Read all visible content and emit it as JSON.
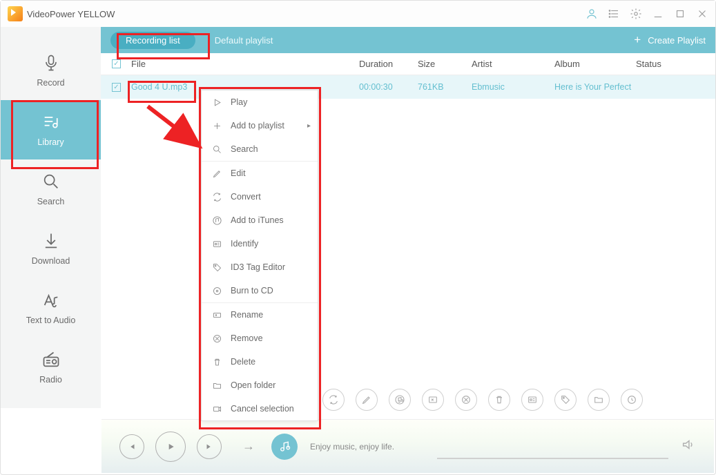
{
  "app_title": "VideoPower YELLOW",
  "sidebar": {
    "items": [
      {
        "label": "Record"
      },
      {
        "label": "Library"
      },
      {
        "label": "Search"
      },
      {
        "label": "Download"
      },
      {
        "label": "Text to Audio"
      },
      {
        "label": "Radio"
      }
    ]
  },
  "tabs": {
    "recording_list": "Recording list",
    "default_playlist": "Default playlist",
    "create_playlist": "Create Playlist"
  },
  "table": {
    "headers": {
      "file": "File",
      "duration": "Duration",
      "size": "Size",
      "artist": "Artist",
      "album": "Album",
      "status": "Status"
    },
    "rows": [
      {
        "file": "Good 4 U.mp3",
        "duration": "00:00:30",
        "size": "761KB",
        "artist": "Ebmusic",
        "album": "Here is Your Perfect"
      }
    ]
  },
  "context_menu": {
    "play": "Play",
    "add_to_playlist": "Add to playlist",
    "search": "Search",
    "edit": "Edit",
    "convert": "Convert",
    "add_to_itunes": "Add to iTunes",
    "identify": "Identify",
    "id3_tag_editor": "ID3 Tag Editor",
    "burn_to_cd": "Burn to CD",
    "rename": "Rename",
    "remove": "Remove",
    "delete": "Delete",
    "open_folder": "Open folder",
    "cancel_selection": "Cancel selection"
  },
  "player": {
    "now_playing": "Enjoy music, enjoy life."
  }
}
